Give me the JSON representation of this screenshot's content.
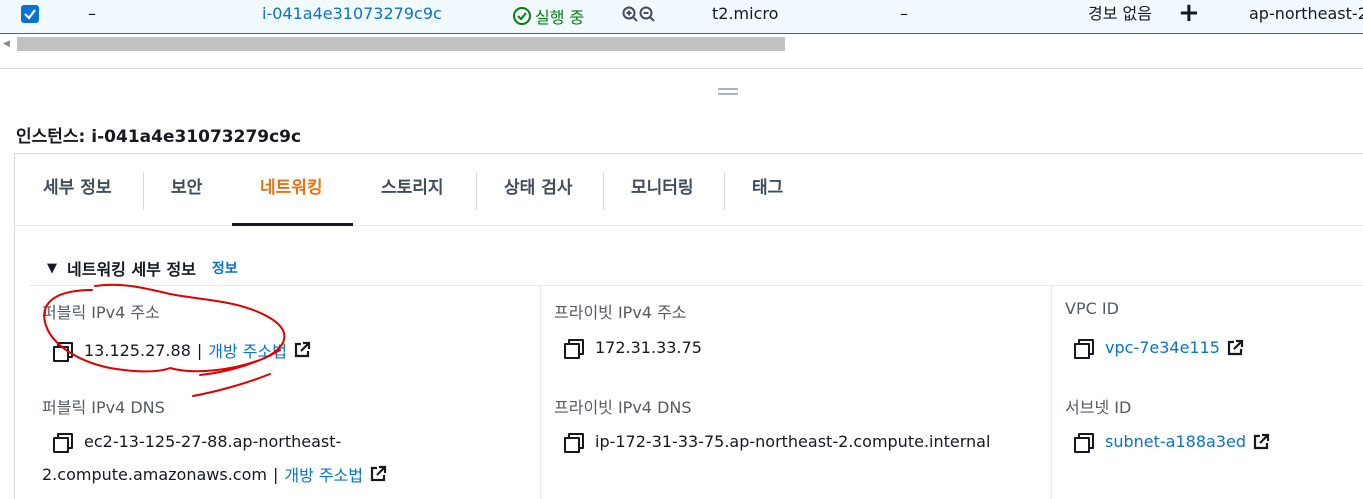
{
  "table_row": {
    "selected": true,
    "name": "–",
    "instance_id": "i-041a4e31073279c9c",
    "state": "실행 중",
    "instance_type": "t2.micro",
    "status_check": "–",
    "alarm_status": "경보 없음",
    "add_alarm": "+",
    "availability_zone": "ap-northeast-2"
  },
  "instance_header": {
    "title": "인스턴스: i-041a4e31073279c9c"
  },
  "tabs": [
    {
      "label": "세부 정보",
      "active": false
    },
    {
      "label": "보안",
      "active": false
    },
    {
      "label": "네트워킹",
      "active": true
    },
    {
      "label": "스토리지",
      "active": false
    },
    {
      "label": "상태 검사",
      "active": false
    },
    {
      "label": "모니터링",
      "active": false
    },
    {
      "label": "태그",
      "active": false
    }
  ],
  "networking": {
    "section_title": "네트워킹 세부 정보",
    "info_link": "정보",
    "public_ipv4_label": "퍼블릭 IPv4 주소",
    "public_ipv4_value": "13.125.27.88",
    "open_address_link": "개방 주소법",
    "private_ipv4_label": "프라이빗 IPv4 주소",
    "private_ipv4_value": "172.31.33.75",
    "vpc_id_label": "VPC ID",
    "vpc_id_value": "vpc-7e34e115",
    "public_dns_label": "퍼블릭 IPv4 DNS",
    "public_dns_line1": "ec2-13-125-27-88.ap-northeast-",
    "public_dns_line2": "2.compute.amazonaws.com",
    "private_dns_label": "프라이빗 IPv4 DNS",
    "private_dns_value": "ip-172-31-33-75.ap-northeast-2.compute.internal",
    "subnet_id_label": "서브넷 ID",
    "subnet_id_value": "subnet-a188a3ed"
  },
  "colors": {
    "link": "#0972d3",
    "active_tab": "#ec7211",
    "running": "#037f0c",
    "annotation": "#e00000"
  }
}
